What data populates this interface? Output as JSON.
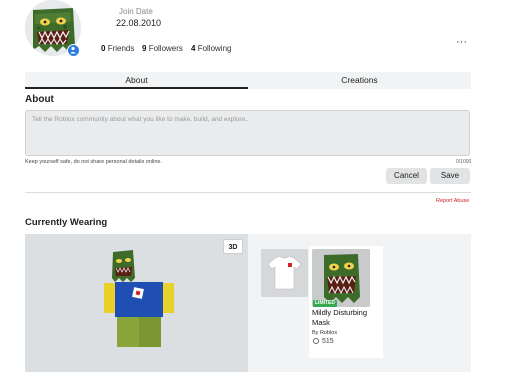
{
  "profile": {
    "join_label": "Join Date",
    "join_date": "22.08.2010",
    "friends_count": "0",
    "friends_label": "Friends",
    "followers_count": "9",
    "followers_label": "Followers",
    "following_count": "4",
    "following_label": "Following",
    "more_label": "···"
  },
  "tabs": [
    {
      "label": "About",
      "active": true
    },
    {
      "label": "Creations",
      "active": false
    }
  ],
  "about": {
    "heading": "About",
    "placeholder": "Tell the Roblox community about what you like to make, build, and explore..",
    "safety_note": "Keep yourself safe, do not share personal details online.",
    "char_counter": "0/1000",
    "cancel_label": "Cancel",
    "save_label": "Save",
    "report_label": "Report Abuse"
  },
  "wearing": {
    "heading": "Currently Wearing",
    "view_toggle": "3D",
    "items": [
      {
        "type": "shirt"
      },
      {
        "type": "hat",
        "badge": "LIMITED",
        "name": "Mildly Disturbing Mask",
        "creator": "By Roblox",
        "price": "515"
      }
    ]
  },
  "colors": {
    "accent_red": "#d2232a",
    "limited_green": "#3aa850",
    "verified_blue": "#2a7be4"
  }
}
